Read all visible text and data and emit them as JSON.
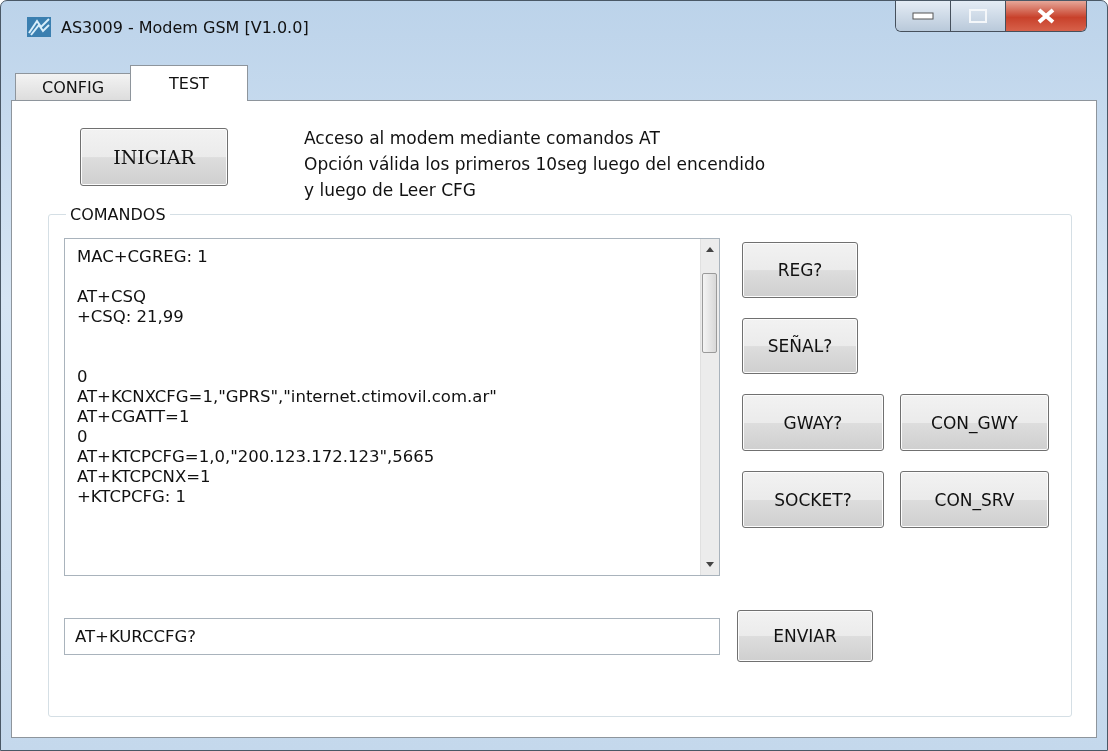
{
  "window": {
    "title": "AS3009 - Modem GSM [V1.0.0]"
  },
  "tabs": [
    {
      "label": "CONFIG",
      "selected": false
    },
    {
      "label": "TEST",
      "selected": true
    }
  ],
  "start_button": "INICIAR",
  "description": [
    "Acceso al modem mediante comandos AT",
    "Opción válida los primeros 10seg luego del encendido",
    "y luego de Leer CFG"
  ],
  "commands": {
    "legend": "COMANDOS",
    "log": [
      [
        "MAC+CGREG: 1"
      ],
      [
        "AT+CSQ",
        "+CSQ: 21,99"
      ],
      [
        "0",
        "AT+KCNXCFG=1,\"GPRS\",\"internet.ctimovil.com.ar\"",
        "AT+CGATT=1",
        "0",
        "AT+KTCPCFG=1,0,\"200.123.172.123\",5665",
        "AT+KTCPCNX=1",
        "+KTCPCFG: 1"
      ]
    ],
    "button_rows": [
      [
        "REG?"
      ],
      [
        "SEÑAL?"
      ],
      [
        "GWAY?",
        "CON_GWY"
      ],
      [
        "SOCKET?",
        "CON_SRV"
      ]
    ],
    "input": {
      "value": "AT+KURCCFG?"
    },
    "send_button": "ENVIAR"
  }
}
